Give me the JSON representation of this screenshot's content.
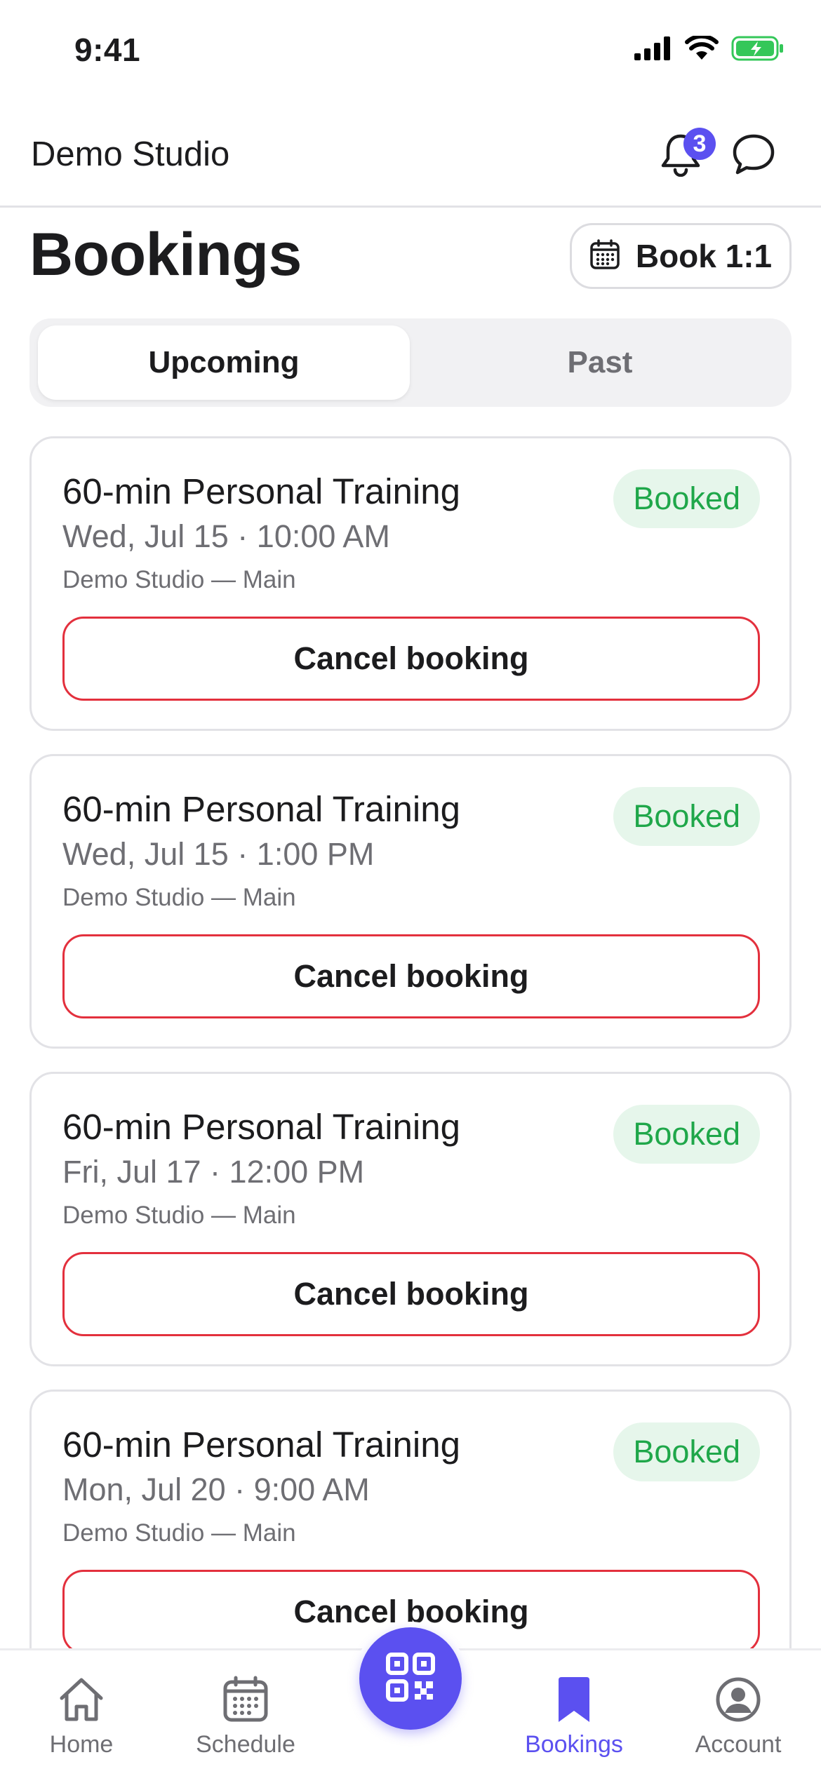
{
  "status_bar": {
    "time": "9:41",
    "icons": [
      "cellular-signal-icon",
      "wifi-icon",
      "battery-charging-icon"
    ]
  },
  "header": {
    "studio_name": "Demo Studio",
    "notification_count": "3",
    "icons": [
      "bell-icon",
      "chat-bubble-icon"
    ]
  },
  "page": {
    "title": "Bookings",
    "book_button_label": "Book 1:1"
  },
  "segments": {
    "active": "Upcoming",
    "options": [
      "Upcoming",
      "Past"
    ]
  },
  "bookings": [
    {
      "title": "60-min Personal Training",
      "datetime": "Wed, Jul 15 · 10:00 AM",
      "location": "Demo Studio — Main",
      "status": "Booked",
      "action": "Cancel booking"
    },
    {
      "title": "60-min Personal Training",
      "datetime": "Wed, Jul 15 · 1:00 PM",
      "location": "Demo Studio — Main",
      "status": "Booked",
      "action": "Cancel booking"
    },
    {
      "title": "60-min Personal Training",
      "datetime": "Fri, Jul 17 · 12:00 PM",
      "location": "Demo Studio — Main",
      "status": "Booked",
      "action": "Cancel booking"
    },
    {
      "title": "60-min Personal Training",
      "datetime": "Mon, Jul 20 · 9:00 AM",
      "location": "Demo Studio — Main",
      "status": "Booked",
      "action": "Cancel booking"
    }
  ],
  "tab_bar": {
    "active": "Bookings",
    "tabs": [
      {
        "label": "Home",
        "icon": "home-icon"
      },
      {
        "label": "Schedule",
        "icon": "calendar-icon"
      },
      {
        "label": "Bookings",
        "icon": "bookmark-icon"
      },
      {
        "label": "Account",
        "icon": "user-circle-icon"
      }
    ],
    "center_action_icon": "qr-code-icon"
  },
  "colors": {
    "accent": "#5b50f0",
    "booked_text": "#1fa74a",
    "booked_bg": "#e6f6eb",
    "cancel_border": "#e3303d",
    "battery": "#34c759"
  }
}
